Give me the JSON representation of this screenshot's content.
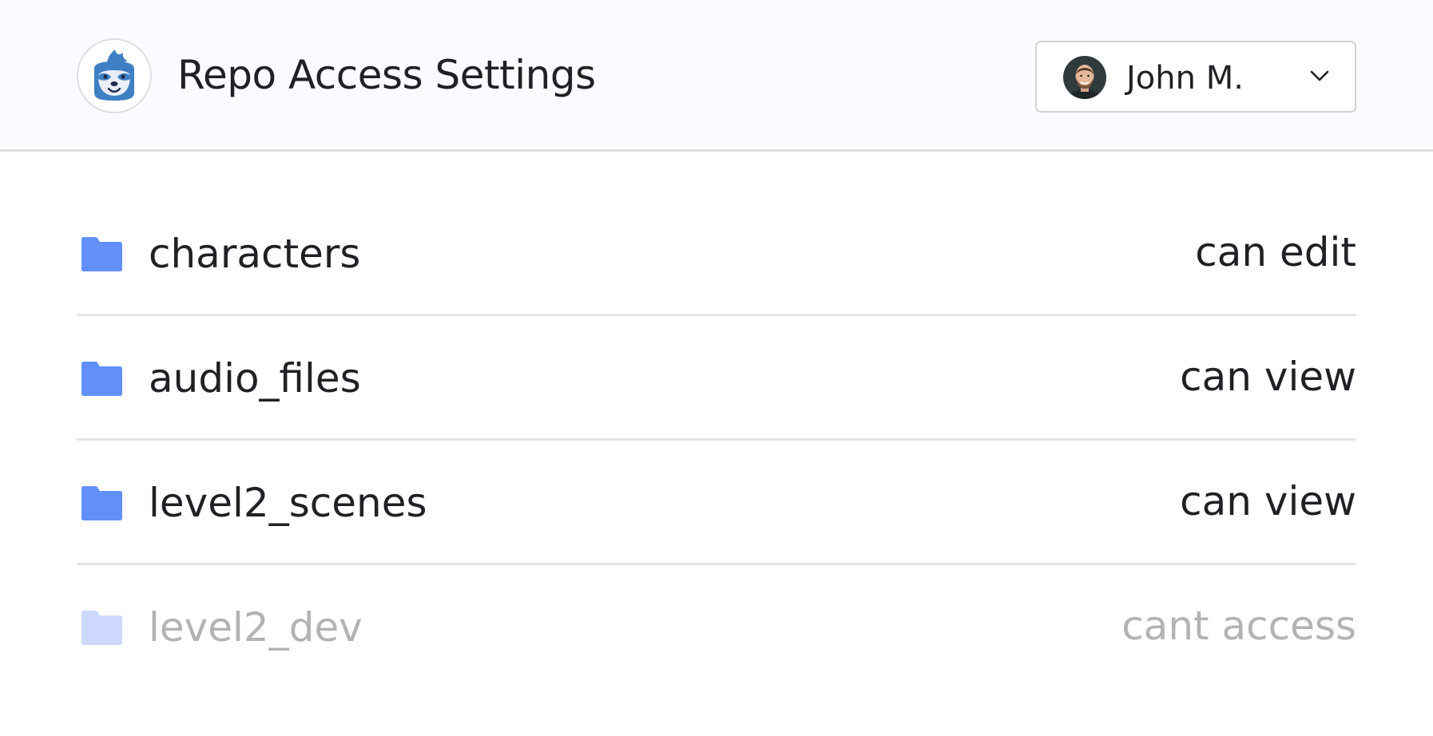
{
  "header": {
    "title": "Repo Access Settings",
    "logo_icon": "sloth-logo-icon",
    "user": {
      "name": "John M.",
      "avatar_icon": "user-avatar",
      "dropdown_icon": "chevron-down-icon"
    }
  },
  "repos": [
    {
      "name": "characters",
      "permission": "can edit",
      "icon": "folder-icon",
      "enabled": true
    },
    {
      "name": "audio_files",
      "permission": "can view",
      "icon": "folder-icon",
      "enabled": true
    },
    {
      "name": "level2_scenes",
      "permission": "can view",
      "icon": "folder-icon",
      "enabled": true
    },
    {
      "name": "level2_dev",
      "permission": "cant access",
      "icon": "folder-icon",
      "enabled": false
    }
  ],
  "colors": {
    "header_bg": "#f9fbfe",
    "folder": "#6290fb",
    "folder_disabled": "#cdd9fd",
    "text": "#1f2124",
    "text_disabled": "#b3b3b3",
    "divider": "#e4e4e4",
    "logo_blue": "#3f80c4"
  }
}
